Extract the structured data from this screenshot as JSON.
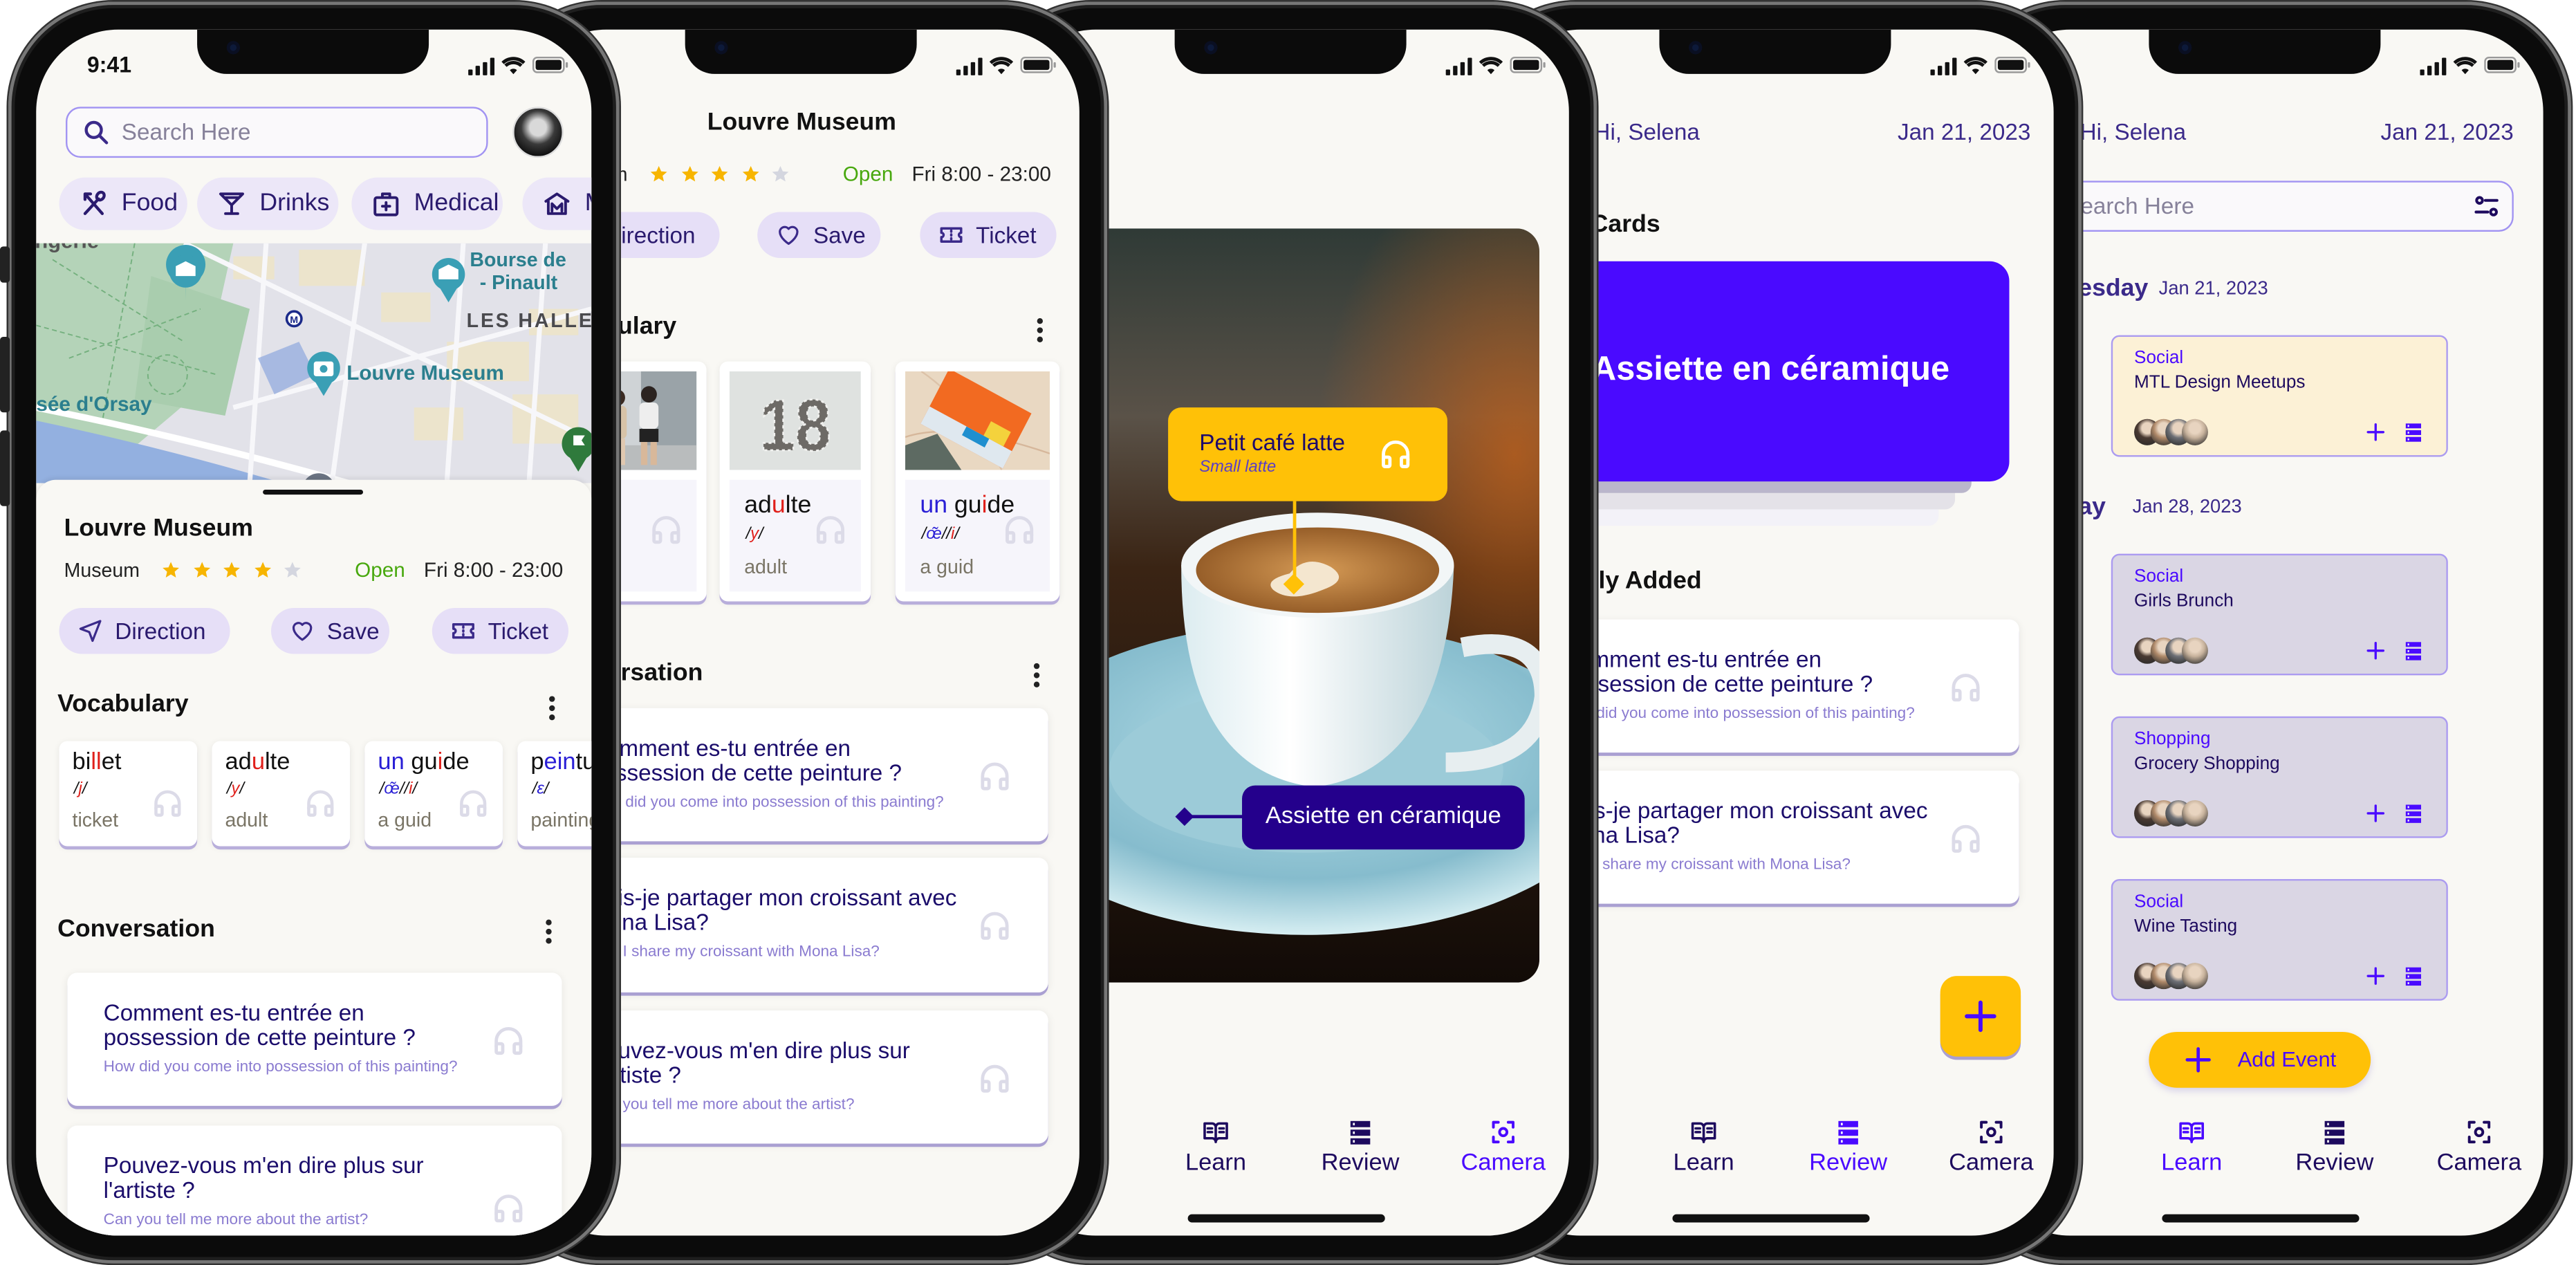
{
  "colors": {
    "background": "#f9f8f4",
    "accent": "#4a0aff",
    "navy": "#1d0a6b",
    "yellow": "#ffc107",
    "chip": "#ece7f8",
    "open": "#48a80e",
    "star_on": "#f7b500",
    "star_off": "#d4d6df",
    "event_highlight": "#fcf1d6",
    "event_default": "#dad6e4",
    "red": "#e0201b",
    "blue": "#2a1fd6"
  },
  "status": {
    "time": "9:41"
  },
  "search": {
    "placeholder": "Search Here"
  },
  "categories": [
    {
      "label": "Food",
      "icon": "fork-spoon-icon"
    },
    {
      "label": "Drinks",
      "icon": "cocktail-icon"
    },
    {
      "label": "Medical",
      "icon": "medical-kit-icon"
    },
    {
      "label": "Museum",
      "icon": "museum-icon"
    }
  ],
  "map": {
    "labels": [
      "angerie",
      "Bourse de",
      "- Pinault",
      "LES HALLES",
      "Louvre Museum",
      "Musée d'Orsay"
    ]
  },
  "place": {
    "name": "Louvre Museum",
    "type": "Museum",
    "rating": 4,
    "rating_max": 5,
    "status": "Open",
    "hours": "Fri 8:00 - 23:00"
  },
  "actions": [
    {
      "label": "Direction",
      "icon": "direction-icon"
    },
    {
      "label": "Save",
      "icon": "heart-icon"
    },
    {
      "label": "Ticket",
      "icon": "ticket-icon"
    }
  ],
  "sections": {
    "vocabulary": "Vocabulary",
    "conversation": "Conversation"
  },
  "vocab": [
    {
      "word": [
        {
          "t": "bi"
        },
        {
          "t": "ll",
          "c": "red"
        },
        {
          "t": "et"
        }
      ],
      "phonetic": [
        {
          "t": "/"
        },
        {
          "t": "j",
          "c": "red"
        },
        {
          "t": "/"
        }
      ],
      "translation": "ticket",
      "image": "people-photo"
    },
    {
      "word": [
        {
          "t": "ad"
        },
        {
          "t": "u",
          "c": "red"
        },
        {
          "t": "lte"
        }
      ],
      "phonetic": [
        {
          "t": "/"
        },
        {
          "t": "y",
          "c": "red"
        },
        {
          "t": "/"
        }
      ],
      "translation": "adult",
      "image": "number-18-photo",
      "image_text": "18"
    },
    {
      "word": [
        {
          "t": "un",
          "c": "blue"
        },
        {
          "t": " gu"
        },
        {
          "t": "i",
          "c": "red"
        },
        {
          "t": "de"
        }
      ],
      "phonetic": [
        {
          "t": "/"
        },
        {
          "t": "œ̃",
          "c": "blue"
        },
        {
          "t": "//"
        },
        {
          "t": "i",
          "c": "red"
        },
        {
          "t": "/"
        }
      ],
      "translation": "a guid",
      "image": "map-guide-photo"
    },
    {
      "word": [
        {
          "t": "p"
        },
        {
          "t": "ein",
          "c": "blue"
        },
        {
          "t": "ture"
        }
      ],
      "phonetic": [
        {
          "t": "/"
        },
        {
          "t": "ɛ",
          "c": "blue"
        },
        {
          "t": "/"
        }
      ],
      "translation": "painting"
    }
  ],
  "conversations": [
    {
      "fr": "Comment es-tu entrée en possession de cette peinture ?",
      "en": "How did you come into possession of this painting?"
    },
    {
      "fr": "Puis-je partager mon croissant avec Mona Lisa?",
      "en": "Can I share my croissant with Mona Lisa?"
    },
    {
      "fr": "Pouvez-vous m'en dire plus sur l'artiste ?",
      "en": "Can you tell me more about the artist?"
    }
  ],
  "camera": {
    "primary_label": {
      "word": "Petit café latte",
      "translation": "Small latte"
    },
    "secondary_label": {
      "word": "Assiette en céramique"
    }
  },
  "nav": [
    {
      "label": "Learn",
      "icon": "book-icon"
    },
    {
      "label": "Review",
      "icon": "cards-stack-icon"
    },
    {
      "label": "Camera",
      "icon": "camera-scan-icon"
    }
  ],
  "review": {
    "greeting": "Hi, Selena",
    "date": "Jan 21, 2023",
    "cards_heading": "Cards",
    "card_word": "Assiette en céramique",
    "recent_heading": "tly Added",
    "active_tab": "Review"
  },
  "calendar": {
    "greeting": "Hi, Selena",
    "date": "Jan 21, 2023",
    "search_placeholder": "Search Here",
    "days": [
      {
        "label": "esday",
        "date": "Jan 21, 2023",
        "events": [
          {
            "category": "Social",
            "title": "MTL Design Meetups",
            "highlight": true
          }
        ]
      },
      {
        "label": "ay",
        "date": "Jan 28, 2023",
        "events": [
          {
            "category": "Social",
            "title": "Girls Brunch",
            "highlight": false
          },
          {
            "category": "Shopping",
            "title": "Grocery Shopping",
            "highlight": false
          },
          {
            "category": "Social",
            "title": "Wine Tasting",
            "highlight": false
          }
        ]
      }
    ],
    "add_event": "Add Event",
    "active_tab": "Learn"
  },
  "camera_active_tab": "Camera"
}
